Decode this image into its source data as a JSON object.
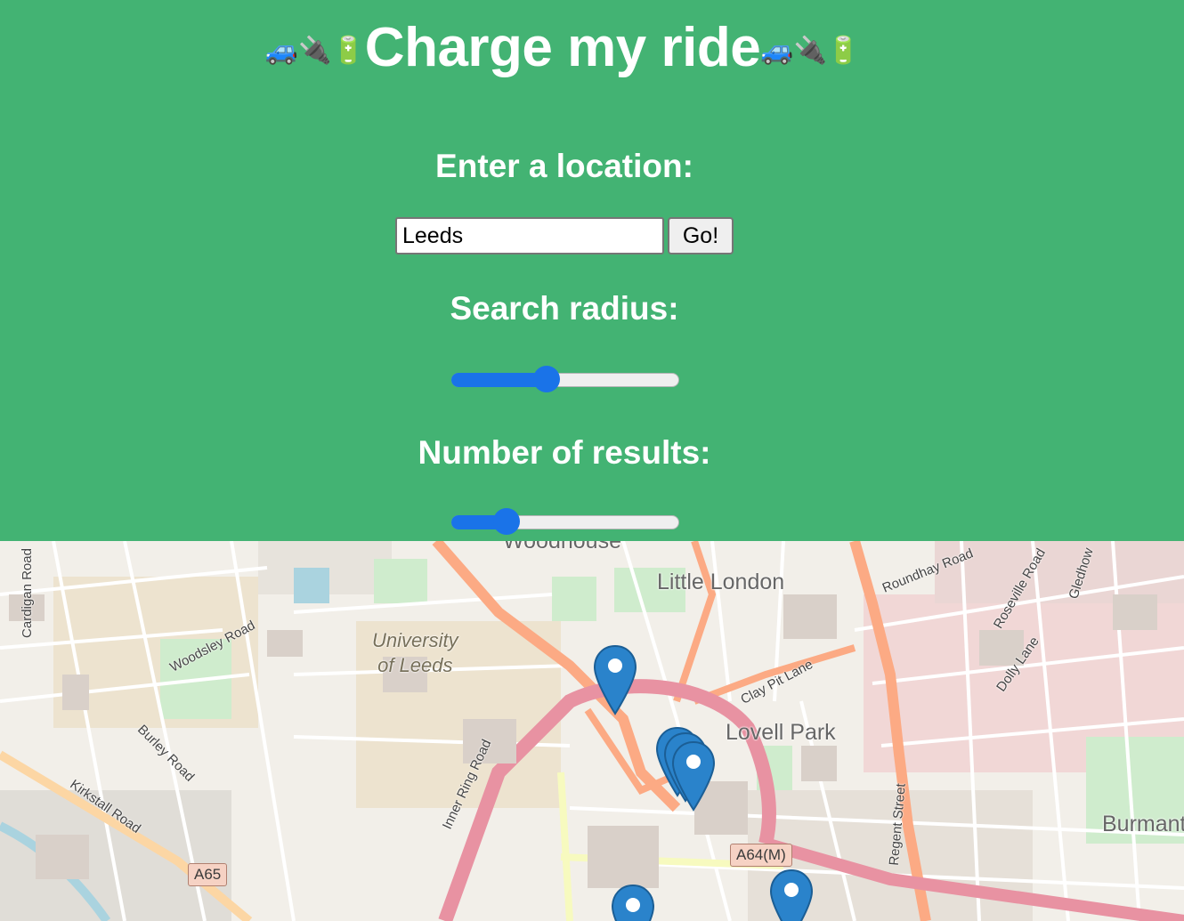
{
  "header": {
    "title": "Charge my ride",
    "title_emoji": "🚙🔌🔋",
    "location_label": "Enter a location:",
    "radius_label": "Search radius:",
    "results_label": "Number of results:"
  },
  "search": {
    "value": "Leeds",
    "go_label": "Go!"
  },
  "sliders": {
    "radius_fraction": 0.41,
    "results_fraction": 0.21
  },
  "map": {
    "districts": [
      "Woodhouse",
      "Little London",
      "Lovell Park",
      "Burmantofts"
    ],
    "university": [
      "University",
      "of Leeds"
    ],
    "roads": [
      "Cardigan Road",
      "Woodsley Road",
      "Burley Road",
      "Kirkstall Road",
      "Inner Ring Road",
      "Clay Pit Lane",
      "Roundhay Road",
      "Roseville Road",
      "Gledhow",
      "Dolly Lane",
      "Regent Street"
    ],
    "shields": [
      "A65",
      "A64(M)"
    ],
    "marker_count": 6
  },
  "colors": {
    "header_bg": "#43b373",
    "slider_accent": "#1a73e8",
    "marker": "#2a83cb"
  }
}
